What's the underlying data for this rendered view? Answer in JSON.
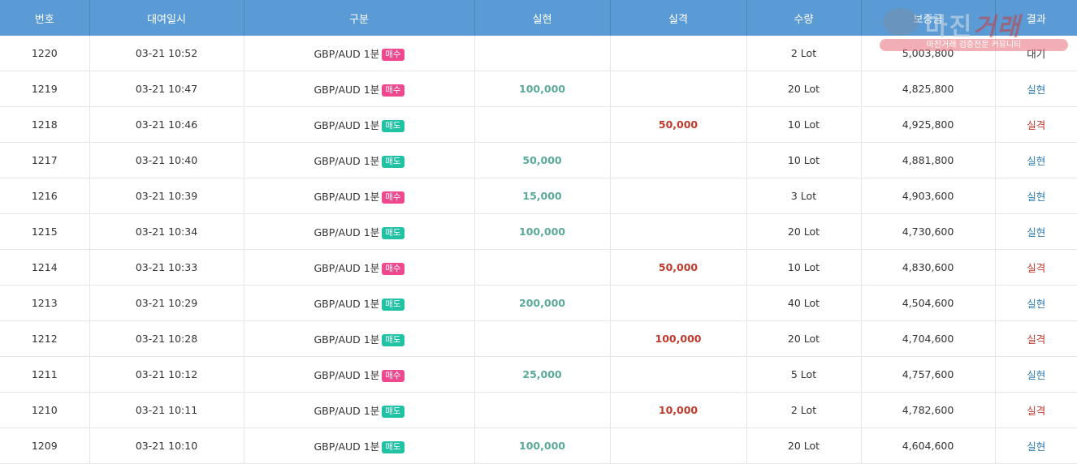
{
  "header": {
    "num": "번호",
    "date": "대여일시",
    "type": "구분",
    "profit": "실현",
    "loss": "실격",
    "qty": "수량",
    "margin": "보증금",
    "result": "결과"
  },
  "colors": {
    "header_bg": "#5b9bd5",
    "buy_badge": "#f0488e",
    "sell_badge": "#1fc3a4",
    "profit_text": "#5aaa9a",
    "loss_text": "#c0392b",
    "win_result": "#2e7db5"
  },
  "rows": [
    {
      "num": "1220",
      "date": "03-21 10:52",
      "symbol": "GBP/AUD 1분",
      "side": "매수",
      "side_kind": "buy",
      "profit": "",
      "loss": "",
      "qty": "2 Lot",
      "margin": "5,003,800",
      "result": "대기",
      "result_kind": "wait"
    },
    {
      "num": "1219",
      "date": "03-21 10:47",
      "symbol": "GBP/AUD 1분",
      "side": "매수",
      "side_kind": "buy",
      "profit": "100,000",
      "loss": "",
      "qty": "20 Lot",
      "margin": "4,825,800",
      "result": "실현",
      "result_kind": "win"
    },
    {
      "num": "1218",
      "date": "03-21 10:46",
      "symbol": "GBP/AUD 1분",
      "side": "매도",
      "side_kind": "sell",
      "profit": "",
      "loss": "50,000",
      "qty": "10 Lot",
      "margin": "4,925,800",
      "result": "실격",
      "result_kind": "lose"
    },
    {
      "num": "1217",
      "date": "03-21 10:40",
      "symbol": "GBP/AUD 1분",
      "side": "매도",
      "side_kind": "sell",
      "profit": "50,000",
      "loss": "",
      "qty": "10 Lot",
      "margin": "4,881,800",
      "result": "실현",
      "result_kind": "win"
    },
    {
      "num": "1216",
      "date": "03-21 10:39",
      "symbol": "GBP/AUD 1분",
      "side": "매수",
      "side_kind": "buy",
      "profit": "15,000",
      "loss": "",
      "qty": "3 Lot",
      "margin": "4,903,600",
      "result": "실현",
      "result_kind": "win"
    },
    {
      "num": "1215",
      "date": "03-21 10:34",
      "symbol": "GBP/AUD 1분",
      "side": "매도",
      "side_kind": "sell",
      "profit": "100,000",
      "loss": "",
      "qty": "20 Lot",
      "margin": "4,730,600",
      "result": "실현",
      "result_kind": "win"
    },
    {
      "num": "1214",
      "date": "03-21 10:33",
      "symbol": "GBP/AUD 1분",
      "side": "매수",
      "side_kind": "buy",
      "profit": "",
      "loss": "50,000",
      "qty": "10 Lot",
      "margin": "4,830,600",
      "result": "실격",
      "result_kind": "lose"
    },
    {
      "num": "1213",
      "date": "03-21 10:29",
      "symbol": "GBP/AUD 1분",
      "side": "매도",
      "side_kind": "sell",
      "profit": "200,000",
      "loss": "",
      "qty": "40 Lot",
      "margin": "4,504,600",
      "result": "실현",
      "result_kind": "win"
    },
    {
      "num": "1212",
      "date": "03-21 10:28",
      "symbol": "GBP/AUD 1분",
      "side": "매도",
      "side_kind": "sell",
      "profit": "",
      "loss": "100,000",
      "qty": "20 Lot",
      "margin": "4,704,600",
      "result": "실격",
      "result_kind": "lose"
    },
    {
      "num": "1211",
      "date": "03-21 10:12",
      "symbol": "GBP/AUD 1분",
      "side": "매수",
      "side_kind": "buy",
      "profit": "25,000",
      "loss": "",
      "qty": "5 Lot",
      "margin": "4,757,600",
      "result": "실현",
      "result_kind": "win"
    },
    {
      "num": "1210",
      "date": "03-21 10:11",
      "symbol": "GBP/AUD 1분",
      "side": "매도",
      "side_kind": "sell",
      "profit": "",
      "loss": "10,000",
      "qty": "2 Lot",
      "margin": "4,782,600",
      "result": "실격",
      "result_kind": "lose"
    },
    {
      "num": "1209",
      "date": "03-21 10:10",
      "symbol": "GBP/AUD 1분",
      "side": "매도",
      "side_kind": "sell",
      "profit": "100,000",
      "loss": "",
      "qty": "20 Lot",
      "margin": "4,604,600",
      "result": "실현",
      "result_kind": "win"
    }
  ],
  "watermark": {
    "title": "마진",
    "title_accent": "거래",
    "subtitle": "마진거래 검증전문 커뮤니티"
  }
}
